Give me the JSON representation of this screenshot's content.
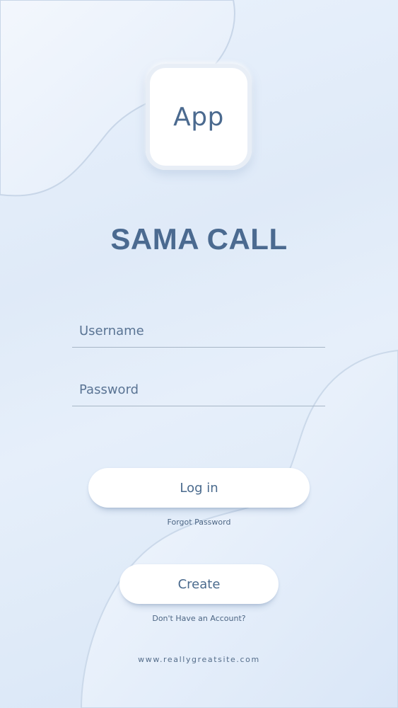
{
  "logo": {
    "label": "App"
  },
  "title": "SAMA CALL",
  "form": {
    "username_placeholder": "Username",
    "username_value": "",
    "password_placeholder": "Password",
    "password_value": ""
  },
  "actions": {
    "login_label": "Log in",
    "forgot_password": "Forgot Password",
    "create_label": "Create",
    "no_account": "Don't Have an Account?"
  },
  "footer": {
    "website": "www.reallygreatsite.com"
  },
  "colors": {
    "accent_text": "#4b6a90",
    "background": "#dfeaf8",
    "button_bg": "#ffffff"
  }
}
